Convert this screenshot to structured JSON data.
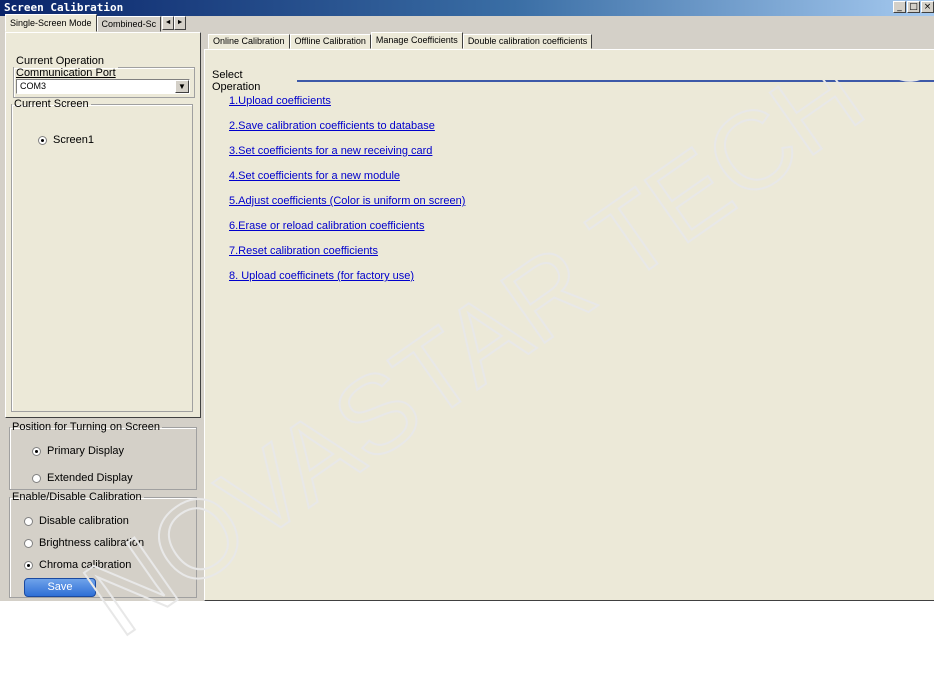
{
  "window": {
    "title": "Screen Calibration",
    "controls": [
      "_",
      "□",
      "×"
    ]
  },
  "left_tabs": {
    "tabs": [
      "Single-Screen Mode",
      "Combined-Sc"
    ],
    "arrows": [
      "◄",
      "►"
    ]
  },
  "current_operation": {
    "legend": "Current Operation",
    "port_label": "Communication Port",
    "port_value": "COM3"
  },
  "current_screen": {
    "legend": "Current Screen",
    "screens": [
      {
        "label": "Screen1",
        "selected": true
      }
    ]
  },
  "position": {
    "legend": "Position for Turning on Screen",
    "options": [
      {
        "label": "Primary Display",
        "selected": true
      },
      {
        "label": "Extended Display",
        "selected": false
      }
    ]
  },
  "calibration": {
    "legend": "Enable/Disable Calibration",
    "options": [
      {
        "label": "Disable calibration",
        "selected": false
      },
      {
        "label": "Brightness calibration",
        "selected": false
      },
      {
        "label": "Chroma calibration",
        "selected": true
      }
    ],
    "save_label": "Save"
  },
  "right_tabs": [
    "Online Calibration",
    "Offline Calibration",
    "Manage Coefficients",
    "Double calibration coefficients"
  ],
  "select_operation": {
    "label": "Select Operation",
    "items": [
      "1.Upload coefficients",
      "2.Save calibration coefficients to database",
      "3.Set coefficients for a new receiving card",
      "4.Set coefficients for a new module",
      "5.Adjust coefficients (Color is uniform on screen)",
      "6.Erase or reload calibration coefficients",
      "7.Reset calibration coefficients",
      "8. Upload coefficinets (for factory use)"
    ]
  },
  "watermark": "NOVASTAR TECH CO., LTD",
  "colors": {
    "titlebar": "#0a246a",
    "link": "#0000cc",
    "save_button": "#2f6fd6",
    "rule": "#3d59a8"
  }
}
